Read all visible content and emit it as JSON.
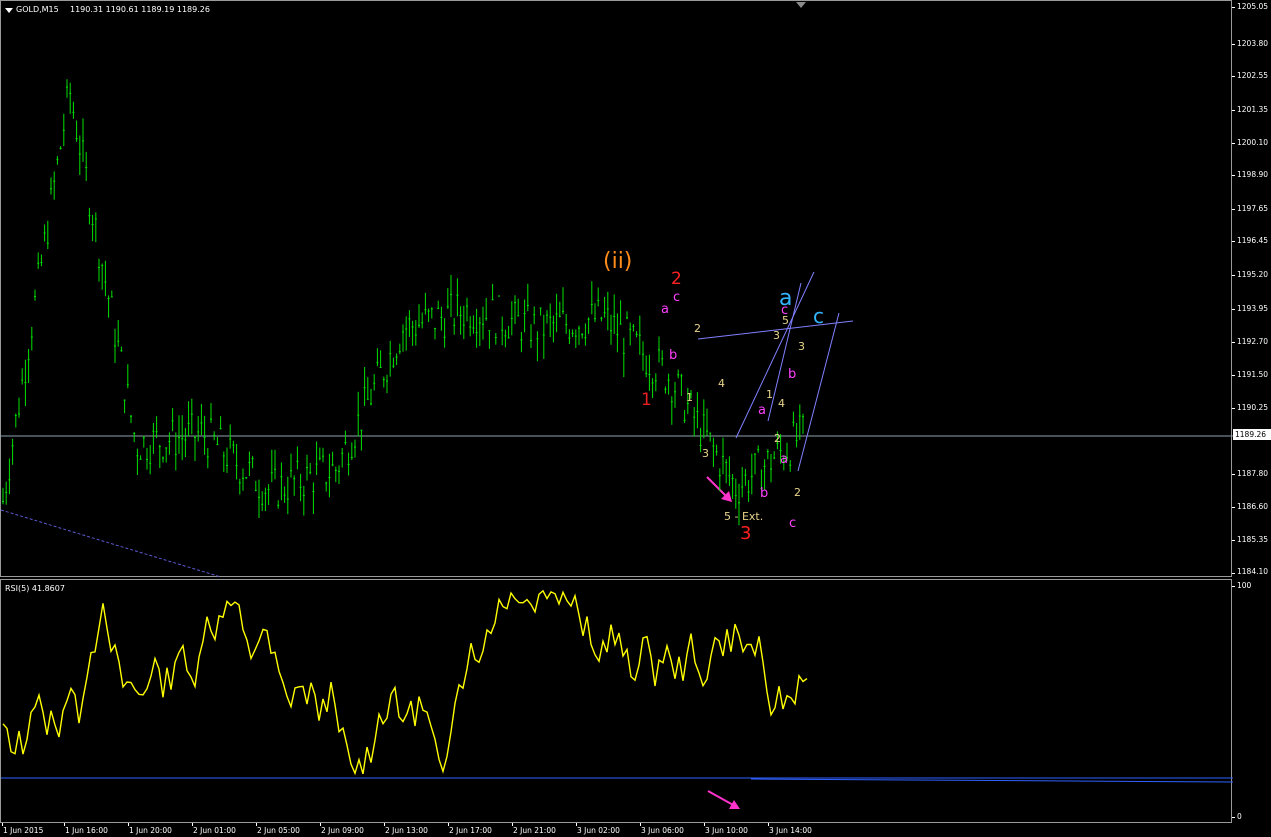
{
  "chart_header": {
    "symbol_timeframe": "GOLD,M15",
    "ohlc": "1190.31 1190.61 1189.19 1189.26"
  },
  "rsi_header": {
    "label": "RSI(5) 41.8607"
  },
  "current_price_label": "1189.26",
  "price_axis": [
    "1205.05",
    "1203.80",
    "1202.55",
    "1201.35",
    "1200.10",
    "1198.90",
    "1197.65",
    "1196.45",
    "1195.20",
    "1193.95",
    "1192.70",
    "1191.50",
    "1190.25",
    "1187.80",
    "1186.60",
    "1185.35",
    "1184.10"
  ],
  "rsi_axis": [
    "100",
    "0"
  ],
  "time_axis": [
    "1 Jun 2015",
    "1 Jun 16:00",
    "1 Jun 20:00",
    "2 Jun 01:00",
    "2 Jun 05:00",
    "2 Jun 09:00",
    "2 Jun 13:00",
    "2 Jun 17:00",
    "2 Jun 21:00",
    "3 Jun 02:00",
    "3 Jun 06:00",
    "3 Jun 10:00",
    "3 Jun 14:00"
  ],
  "wave_labels": [
    {
      "text": "(ii)",
      "color": "#ff8c1a",
      "size": "large"
    },
    {
      "text": "2",
      "color": "#ff2020",
      "size": "large"
    },
    {
      "text": "1",
      "color": "#e82020",
      "size": "large"
    },
    {
      "text": "3",
      "color": "#ff2020",
      "size": "large"
    },
    {
      "text": "a",
      "color": "#33b5ff",
      "size": "xlarge"
    },
    {
      "text": "c",
      "color": "#33b5ff",
      "size": "xlarge"
    },
    {
      "text": "a",
      "color": "#ff40ff",
      "size": "medium"
    },
    {
      "text": "c",
      "color": "#ff40ff",
      "size": "medium"
    },
    {
      "text": "b",
      "color": "#ff40ff",
      "size": "medium"
    },
    {
      "text": "a",
      "color": "#ff40ff",
      "size": "medium"
    },
    {
      "text": "b",
      "color": "#ff40ff",
      "size": "medium"
    },
    {
      "text": "c",
      "color": "#ff40ff",
      "size": "medium"
    },
    {
      "text": "b",
      "color": "#ff40ff",
      "size": "medium"
    },
    {
      "text": "a",
      "color": "#ff40ff",
      "size": "medium"
    },
    {
      "text": "c",
      "color": "#ff40ff",
      "size": "medium"
    },
    {
      "text": "2",
      "color": "#e8d48a",
      "size": "small"
    },
    {
      "text": "1",
      "color": "#e8d48a",
      "size": "small"
    },
    {
      "text": "4",
      "color": "#e8d48a",
      "size": "small"
    },
    {
      "text": "3",
      "color": "#e8d48a",
      "size": "small"
    },
    {
      "text": "5 - Ext.",
      "color": "#e8d48a",
      "size": "small"
    },
    {
      "text": "5",
      "color": "#e8d48a",
      "size": "small"
    },
    {
      "text": "3",
      "color": "#e8d48a",
      "size": "small"
    },
    {
      "text": "1",
      "color": "#e8d48a",
      "size": "small"
    },
    {
      "text": "4",
      "color": "#e8d48a",
      "size": "small"
    },
    {
      "text": "2",
      "color": "#e8d48a",
      "size": "small"
    },
    {
      "text": "3",
      "color": "#e8d48a",
      "size": "small"
    },
    {
      "text": "2",
      "color": "#e8d48a",
      "size": "small"
    }
  ],
  "colors": {
    "candles": "#00e000",
    "rsi_line": "#ffff00",
    "trendlines": "#8080ff",
    "rsi_level": "#3060ff",
    "arrow": "#ff33cc"
  },
  "chart_data": {
    "type": "line",
    "series": [
      {
        "x": [
          "1 Jun 2015",
          "1 Jun 16:00",
          "1 Jun 20:00",
          "2 Jun 01:00",
          "2 Jun 05:00",
          "2 Jun 09:00",
          "2 Jun 13:00",
          "2 Jun 17:00",
          "2 Jun 21:00",
          "3 Jun 02:00",
          "3 Jun 06:00",
          "3 Jun 10:00",
          "3 Jun 14:00"
        ],
        "values": [
          1186.8,
          1202.0,
          1188.9,
          1189.3,
          1187.2,
          1188.0,
          1193.2,
          1193.9,
          1193.2,
          1193.6,
          1191.4,
          1187.3,
          1189.26
        ]
      }
    ],
    "ylim": [
      1184.1,
      1205.05
    ]
  }
}
